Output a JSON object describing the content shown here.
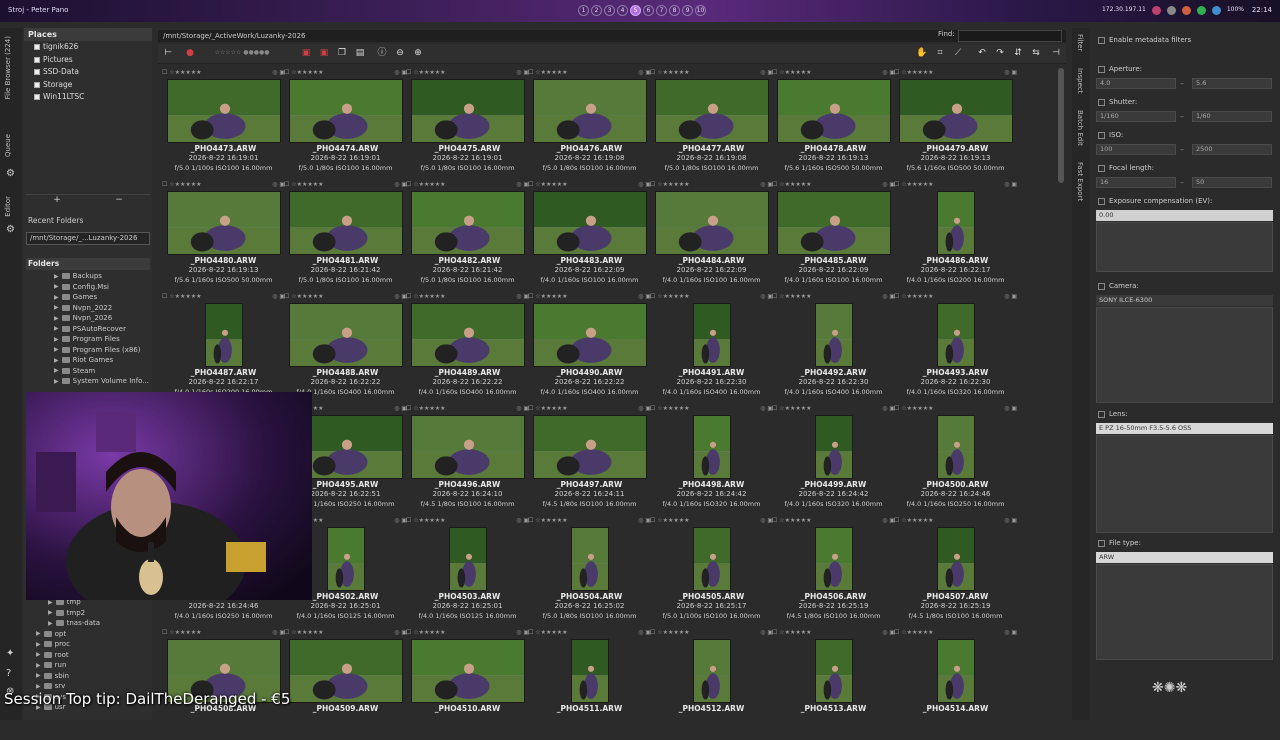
{
  "window": {
    "title": "Stroj - Peter Pano"
  },
  "workspaces": [
    "1",
    "2",
    "3",
    "4",
    "5",
    "6",
    "7",
    "8",
    "9",
    "10"
  ],
  "workspace_active": 4,
  "tray": {
    "ip": "172.30.197.11",
    "battery": "100%",
    "clock": "22:14"
  },
  "left_tabs": [
    "File Browser (224)",
    "Queue",
    "Editor"
  ],
  "places": {
    "header": "Places",
    "items": [
      "tignik626",
      "Pictures",
      "SSD-Data",
      "Storage",
      "Win11LTSC"
    ],
    "add": "+",
    "remove": "−"
  },
  "recent": {
    "label": "Recent Folders",
    "value": "/mnt/Storage/_...Luzanky-2026"
  },
  "folders": {
    "header": "Folders",
    "items": [
      "Backups",
      "Config.Msi",
      "Games",
      "Nvpn_2022",
      "Nvpn_2026",
      "PSAutoRecover",
      "Program Files",
      "Program Files (x86)",
      "Riot Games",
      "Steam",
      "System Volume Info..."
    ],
    "lower_items": [
      "tmp",
      "tmp2",
      "tnas-data",
      "opt",
      "proc",
      "root",
      "run",
      "sbin",
      "srv",
      "sys",
      "usr"
    ]
  },
  "path": "/mnt/Storage/_ActiveWork/Luzanky-2026",
  "find_label": "Find:",
  "rows": [
    [
      {
        "name": "_PHO4473.ARW",
        "date": "2026-8-22 16:19:01",
        "exif": "f/5.0 1/100s ISO100 16.00mm"
      },
      {
        "name": "_PHO4474.ARW",
        "date": "2026-8-22 16:19:01",
        "exif": "f/5.0 1/80s ISO100 16.00mm"
      },
      {
        "name": "_PHO4475.ARW",
        "date": "2026-8-22 16:19:01",
        "exif": "f/5.0 1/80s ISO100 16.00mm"
      },
      {
        "name": "_PHO4476.ARW",
        "date": "2026-8-22 16:19:08",
        "exif": "f/5.0 1/80s ISO100 16.00mm"
      },
      {
        "name": "_PHO4477.ARW",
        "date": "2026-8-22 16:19:08",
        "exif": "f/5.0 1/80s ISO100 16.00mm"
      },
      {
        "name": "_PHO4478.ARW",
        "date": "2026-8-22 16:19:13",
        "exif": "f/5.6 1/160s ISO500 50.00mm"
      },
      {
        "name": "_PHO4479.ARW",
        "date": "2026-8-22 16:19:13",
        "exif": "f/5.6 1/160s ISO500 50.00mm"
      }
    ],
    [
      {
        "name": "_PHO4480.ARW",
        "date": "2026-8-22 16:19:13",
        "exif": "f/5.6 1/160s ISO500 50.00mm"
      },
      {
        "name": "_PHO4481.ARW",
        "date": "2026-8-22 16:21:42",
        "exif": "f/5.0 1/80s ISO100 16.00mm"
      },
      {
        "name": "_PHO4482.ARW",
        "date": "2026-8-22 16:21:42",
        "exif": "f/5.0 1/80s ISO100 16.00mm"
      },
      {
        "name": "_PHO4483.ARW",
        "date": "2026-8-22 16:22:09",
        "exif": "f/4.0 1/160s ISO100 16.00mm"
      },
      {
        "name": "_PHO4484.ARW",
        "date": "2026-8-22 16:22:09",
        "exif": "f/4.0 1/160s ISO100 16.00mm"
      },
      {
        "name": "_PHO4485.ARW",
        "date": "2026-8-22 16:22:09",
        "exif": "f/4.0 1/160s ISO100 16.00mm"
      },
      {
        "name": "_PHO4486.ARW",
        "date": "2026-8-22 16:22:17",
        "exif": "f/4.0 1/160s ISO200 16.00mm"
      }
    ],
    [
      {
        "name": "_PHO4487.ARW",
        "date": "2026-8-22 16:22:17",
        "exif": "f/4.0 1/160s ISO200 16.00mm"
      },
      {
        "name": "_PHO4488.ARW",
        "date": "2026-8-22 16:22:22",
        "exif": "f/4.0 1/160s ISO400 16.00mm"
      },
      {
        "name": "_PHO4489.ARW",
        "date": "2026-8-22 16:22:22",
        "exif": "f/4.0 1/160s ISO400 16.00mm"
      },
      {
        "name": "_PHO4490.ARW",
        "date": "2026-8-22 16:22:22",
        "exif": "f/4.0 1/160s ISO400 16.00mm"
      },
      {
        "name": "_PHO4491.ARW",
        "date": "2026-8-22 16:22:30",
        "exif": "f/4.0 1/160s ISO400 16.00mm"
      },
      {
        "name": "_PHO4492.ARW",
        "date": "2026-8-22 16:22:30",
        "exif": "f/4.0 1/160s ISO400 16.00mm"
      },
      {
        "name": "_PHO4493.ARW",
        "date": "2026-8-22 16:22:30",
        "exif": "f/4.0 1/160s ISO320 16.00mm"
      }
    ],
    [
      {
        "name": "",
        "date": "",
        "exif": ""
      },
      {
        "name": "_PHO4495.ARW",
        "date": "2026-8-22 16:22:51",
        "exif": "f/4.0 1/160s ISO250 16.00mm"
      },
      {
        "name": "_PHO4496.ARW",
        "date": "2026-8-22 16:24:10",
        "exif": "f/4.5 1/80s ISO100 16.00mm"
      },
      {
        "name": "_PHO4497.ARW",
        "date": "2026-8-22 16:24:11",
        "exif": "f/4.5 1/80s ISO100 16.00mm"
      },
      {
        "name": "_PHO4498.ARW",
        "date": "2026-8-22 16:24:42",
        "exif": "f/4.0 1/160s ISO320 16.00mm"
      },
      {
        "name": "_PHO4499.ARW",
        "date": "2026-8-22 16:24:42",
        "exif": "f/4.0 1/160s ISO320 16.00mm"
      },
      {
        "name": "_PHO4500.ARW",
        "date": "2026-8-22 16:24:46",
        "exif": "f/4.0 1/160s ISO250 16.00mm"
      }
    ],
    [
      {
        "name": "",
        "date": "2026-8-22 16:24:46",
        "exif": "f/4.0 1/160s ISO250 16.00mm"
      },
      {
        "name": "_PHO4502.ARW",
        "date": "2026-8-22 16:25:01",
        "exif": "f/4.0 1/160s ISO125 16.00mm"
      },
      {
        "name": "_PHO4503.ARW",
        "date": "2026-8-22 16:25:01",
        "exif": "f/4.0 1/160s ISO125 16.00mm"
      },
      {
        "name": "_PHO4504.ARW",
        "date": "2026-8-22 16:25:02",
        "exif": "f/5.0 1/80s ISO100 16.00mm"
      },
      {
        "name": "_PHO4505.ARW",
        "date": "2026-8-22 16:25:17",
        "exif": "f/5.0 1/100s ISO100 16.00mm"
      },
      {
        "name": "_PHO4506.ARW",
        "date": "2026-8-22 16:25:19",
        "exif": "f/4.5 1/80s ISO100 16.00mm"
      },
      {
        "name": "_PHO4507.ARW",
        "date": "2026-8-22 16:25:19",
        "exif": "f/4.5 1/80s ISO100 16.00mm"
      }
    ],
    [
      {
        "name": "_PHO4508.ARW",
        "date": "",
        "exif": ""
      },
      {
        "name": "_PHO4509.ARW",
        "date": "",
        "exif": ""
      },
      {
        "name": "_PHO4510.ARW",
        "date": "",
        "exif": ""
      },
      {
        "name": "_PHO4511.ARW",
        "date": "",
        "exif": ""
      },
      {
        "name": "_PHO4512.ARW",
        "date": "",
        "exif": ""
      },
      {
        "name": "_PHO4513.ARW",
        "date": "",
        "exif": ""
      },
      {
        "name": "_PHO4514.ARW",
        "date": "",
        "exif": ""
      }
    ]
  ],
  "right_tabs": [
    "Filter",
    "Inspect",
    "Batch Edit",
    "Fast Export"
  ],
  "filter": {
    "enable": "Enable metadata filters",
    "aperture": {
      "label": "Aperture:",
      "from": "4.0",
      "to": "5.6"
    },
    "shutter": {
      "label": "Shutter:",
      "from": "1/160",
      "to": "1/60"
    },
    "iso": {
      "label": "ISO:",
      "from": "100",
      "to": "2500"
    },
    "focal": {
      "label": "Focal length:",
      "from": "16",
      "to": "50"
    },
    "expcomp": {
      "label": "Exposure compensation (EV):",
      "value": "0.00"
    },
    "camera": {
      "label": "Camera:",
      "value": "SONY ILCE-6300"
    },
    "lens": {
      "label": "Lens:",
      "value": "E PZ 16-50mm F3.5-5.6 OSS"
    },
    "filetype": {
      "label": "File type:",
      "value": "ARW"
    },
    "dash": "–"
  },
  "overlay": {
    "tip": "Session Top tip: DailTheDeranged - €5"
  },
  "colors": {
    "accent": "#b070e0",
    "sky": "#6a8db0"
  }
}
